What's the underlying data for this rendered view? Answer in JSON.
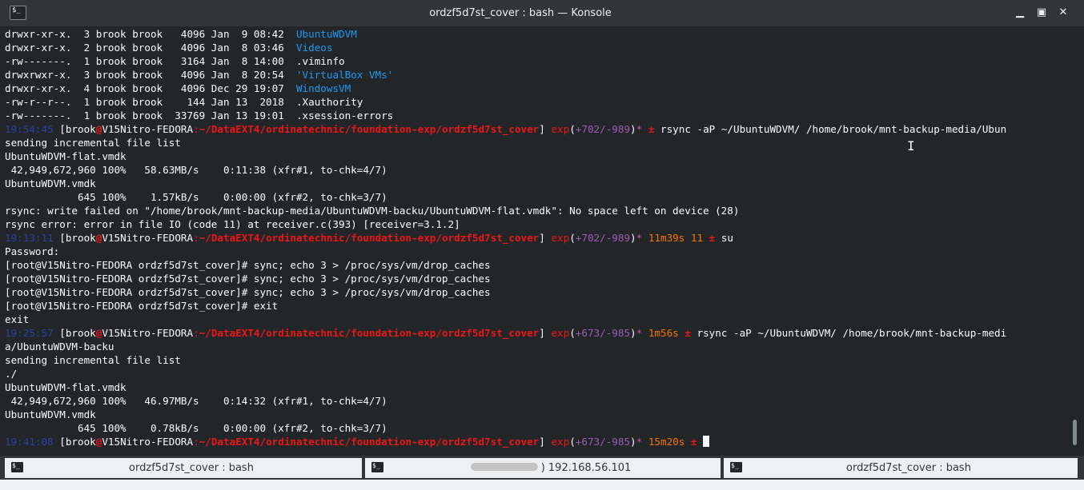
{
  "window": {
    "title": "ordzf5d7st_cover : bash — Konsole",
    "icon": "terminal-icon",
    "controls": {
      "minimize": "▁",
      "maximize": "▣",
      "close": "✕"
    }
  },
  "terminal": {
    "listing": [
      {
        "perm": "drwxr-xr-x.",
        "links": " 3",
        "owner": "brook brook",
        "size": "  4096",
        "date": "Jan  9 08:42",
        "name": "UbuntuWDVM",
        "type": "dir"
      },
      {
        "perm": "drwxr-xr-x.",
        "links": " 2",
        "owner": "brook brook",
        "size": "  4096",
        "date": "Jan  8 03:46",
        "name": "Videos",
        "type": "dir"
      },
      {
        "perm": "-rw-------.",
        "links": " 1",
        "owner": "brook brook",
        "size": "  3164",
        "date": "Jan  8 14:00",
        "name": ".viminfo",
        "type": "file"
      },
      {
        "perm": "drwxrwxr-x.",
        "links": " 3",
        "owner": "brook brook",
        "size": "  4096",
        "date": "Jan  8 20:54",
        "name": "'VirtualBox VMs'",
        "type": "dir"
      },
      {
        "perm": "drwxr-xr-x.",
        "links": " 4",
        "owner": "brook brook",
        "size": "  4096",
        "date": "Dec 29 19:07",
        "name": "WindowsVM",
        "type": "dir"
      },
      {
        "perm": "-rw-r--r--.",
        "links": " 1",
        "owner": "brook brook",
        "size": "   144",
        "date": "Jan 13  2018",
        "name": ".Xauthority",
        "type": "file"
      },
      {
        "perm": "-rw-------.",
        "links": " 1",
        "owner": "brook brook",
        "size": " 33769",
        "date": "Jan 13 19:01",
        "name": ".xsession-errors",
        "type": "file"
      }
    ],
    "prompt": {
      "user_host_open": " [brook",
      "at": "@",
      "host": "V15Nitro-FEDORA",
      "colon": ":",
      "path": "~/DataEXT4/ordinatechnic/foundation-exp/ordzf5d7st_cover",
      "close": "]",
      "git_label": "exp",
      "plusminus": "±"
    },
    "prompt1": {
      "time": "19:54:45",
      "git_counts": "+702/-989",
      "dirty": "*",
      "command": "rsync -aP ~/UbuntuWDVM/ /home/brook/mnt-backup-media/Ubun"
    },
    "block1": [
      "sending incremental file list",
      "UbuntuWDVM-flat.vmdk",
      " 42,949,672,960 100%   58.63MB/s    0:11:38 (xfr#1, to-chk=4/7)",
      "UbuntuWDVM.vmdk",
      "            645 100%    1.57kB/s    0:00:00 (xfr#2, to-chk=3/7)",
      "rsync: write failed on \"/home/brook/mnt-backup-media/UbuntuWDVM-backu/UbuntuWDVM-flat.vmdk\": No space left on device (28)",
      "rsync error: error in file IO (code 11) at receiver.c(393) [receiver=3.1.2]"
    ],
    "prompt2": {
      "time": "19:13:11",
      "git_counts": "+702/-989",
      "dirty": "*",
      "duration": "11m39s",
      "exit_code": "11",
      "command": "su"
    },
    "block2": [
      "Password:",
      "[root@V15Nitro-FEDORA ordzf5d7st_cover]# sync; echo 3 > /proc/sys/vm/drop_caches",
      "[root@V15Nitro-FEDORA ordzf5d7st_cover]# sync; echo 3 > /proc/sys/vm/drop_caches",
      "[root@V15Nitro-FEDORA ordzf5d7st_cover]# sync; echo 3 > /proc/sys/vm/drop_caches",
      "[root@V15Nitro-FEDORA ordzf5d7st_cover]# exit",
      "exit"
    ],
    "prompt3": {
      "time": "19:25:57",
      "git_counts": "+673/-985",
      "dirty": "*",
      "duration": "1m56s",
      "command": "rsync -aP ~/UbuntuWDVM/ /home/brook/mnt-backup-medi",
      "command_wrap": "a/UbuntuWDVM-backu"
    },
    "block3": [
      "sending incremental file list",
      "./",
      "UbuntuWDVM-flat.vmdk",
      " 42,949,672,960 100%   46.97MB/s    0:14:32 (xfr#1, to-chk=4/7)",
      "UbuntuWDVM.vmdk",
      "            645 100%    0.78kB/s    0:00:00 (xfr#2, to-chk=3/7)"
    ],
    "prompt4": {
      "time": "19:41:08",
      "git_counts": "+673/-985",
      "dirty": "*",
      "duration": "15m20s"
    }
  },
  "tabs": [
    {
      "label": "ordzf5d7st_cover : bash",
      "icon": "terminal-icon"
    },
    {
      "label": "192.168.56.101",
      "icon": "terminal-icon",
      "prefix_blurred": ")"
    },
    {
      "label": "ordzf5d7st_cover : bash",
      "icon": "terminal-icon"
    }
  ]
}
